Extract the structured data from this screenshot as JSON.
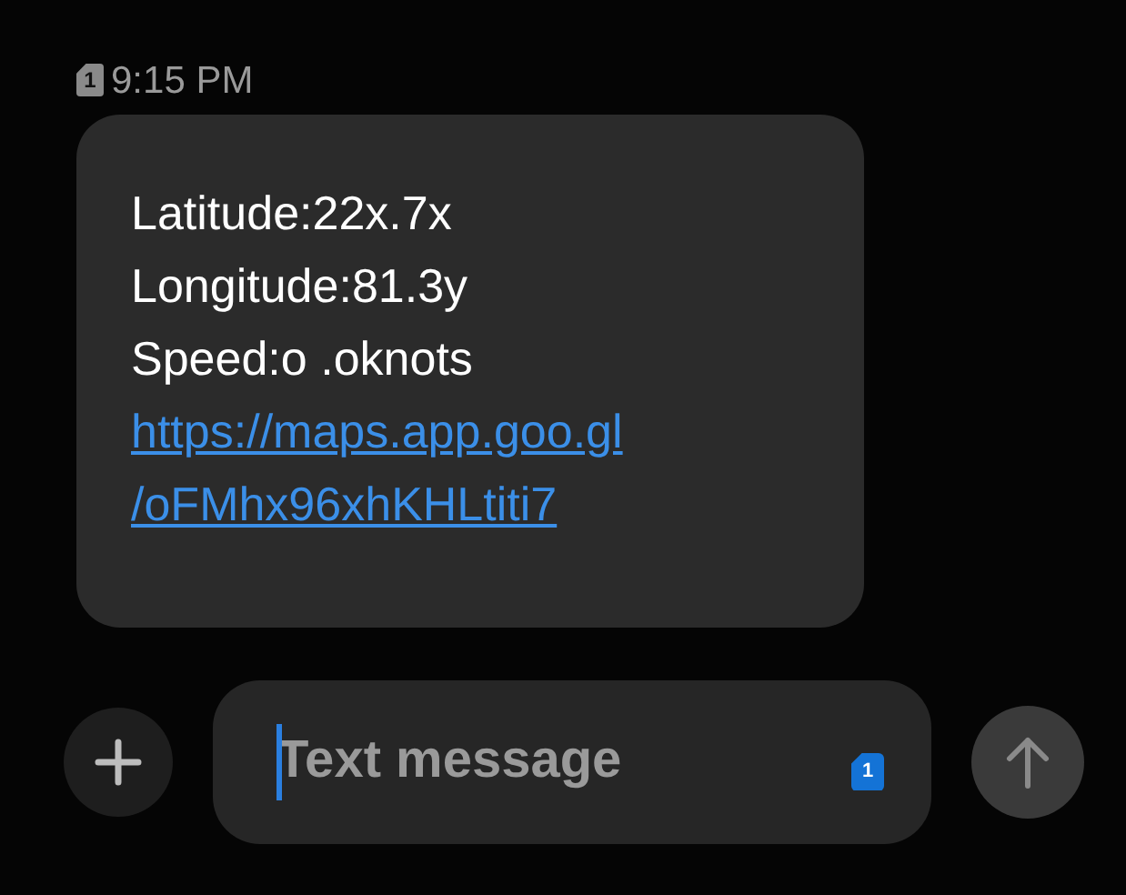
{
  "message": {
    "sim_slot": "1",
    "time": "9:15 PM",
    "lines": [
      "Latitude:22x.7x",
      "Longitude:81.3y",
      "Speed:o .oknots"
    ],
    "link": [
      "https://maps.app.goo.gl",
      "/oFMhx96xhKHLtiti7"
    ]
  },
  "composer": {
    "placeholder": "Text message",
    "sim_slot": "1"
  }
}
